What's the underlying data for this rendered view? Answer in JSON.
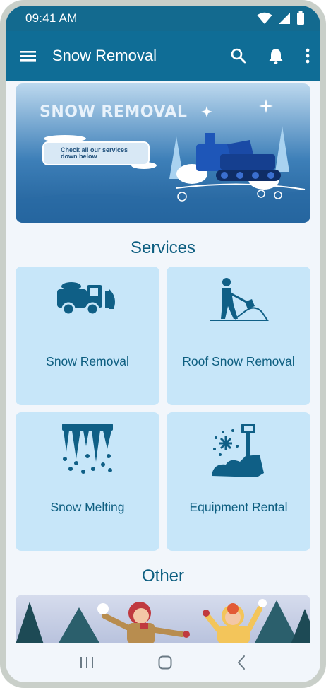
{
  "status_bar": {
    "time": "09:41 AM",
    "icons": [
      "wifi-icon",
      "cell-signal-icon",
      "battery-icon"
    ]
  },
  "app_bar": {
    "title": "Snow Removal",
    "icons": [
      "menu-icon",
      "search-icon",
      "notification-bell-icon",
      "more-vert-icon"
    ]
  },
  "banner": {
    "title": "SNOW REMOVAL",
    "subtitle_line1": "Check all our services",
    "subtitle_line2": "down below"
  },
  "services": {
    "title": "Services",
    "items": [
      {
        "label": "Snow Removal",
        "icon": "snow-plow-truck-icon"
      },
      {
        "label": "Roof Snow Removal",
        "icon": "person-shoveling-icon"
      },
      {
        "label": "Snow Melting",
        "icon": "melting-icicles-icon"
      },
      {
        "label": "Equipment Rental",
        "icon": "snow-shovel-icon"
      }
    ]
  },
  "other": {
    "title": "Other"
  },
  "nav_bar": {
    "icons": [
      "recent-apps-icon",
      "home-icon",
      "back-icon"
    ]
  },
  "colors": {
    "primary": "#0f6d96",
    "status_bar": "#136a8f",
    "card_background": "#c7e6f9",
    "accent_text": "#0d5e80",
    "page_background": "#f2f6fb"
  }
}
